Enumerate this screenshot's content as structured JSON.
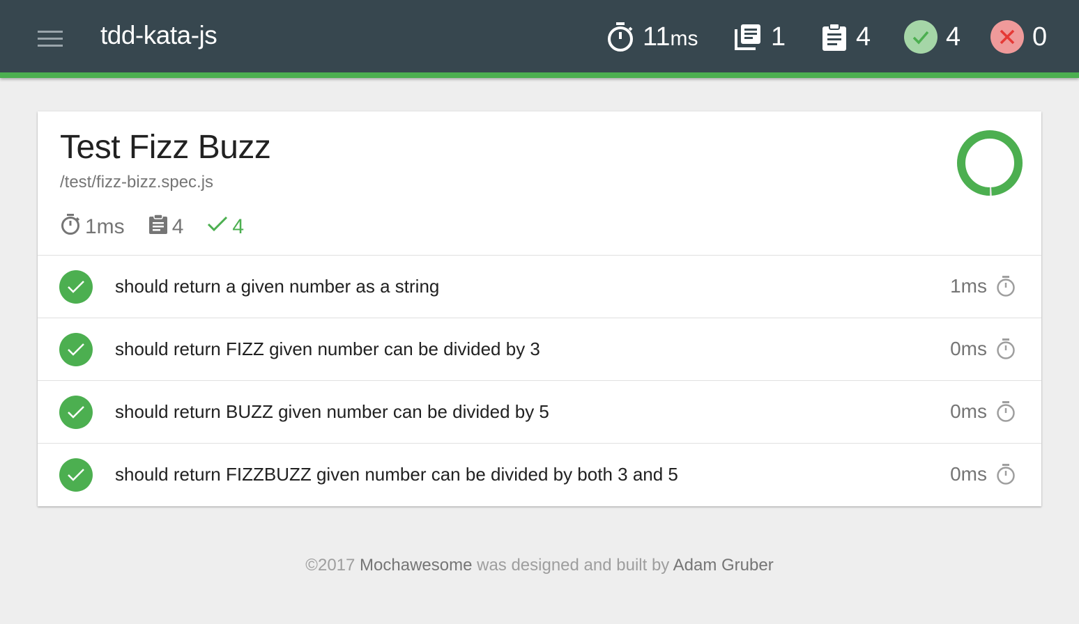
{
  "navbar": {
    "title": "tdd-kata-js",
    "stats": {
      "duration_value": "11",
      "duration_unit": "ms",
      "suites": "1",
      "tests": "4",
      "passes": "4",
      "failures": "0"
    },
    "icons": {
      "menu": "hamburger-icon",
      "duration": "stopwatch-icon",
      "suites": "library-books-icon",
      "tests": "assignment-icon",
      "passes": "check-icon",
      "failures": "close-icon"
    }
  },
  "suite": {
    "title": "Test Fizz Buzz",
    "file": "/test/fizz-bizz.spec.js",
    "duration": "1ms",
    "tests": "4",
    "passes": "4",
    "pass_fraction": 1.0,
    "tests_list": [
      {
        "title": "should return a given number as a string",
        "duration": "1ms",
        "state": "passed"
      },
      {
        "title": "should return FIZZ given number can be divided by 3",
        "duration": "0ms",
        "state": "passed"
      },
      {
        "title": "should return BUZZ given number can be divided by 5",
        "duration": "0ms",
        "state": "passed"
      },
      {
        "title": "should return FIZZBUZZ given number can be divided by both 3 and 5",
        "duration": "0ms",
        "state": "passed"
      }
    ]
  },
  "footer": {
    "prefix": "©2017 ",
    "brand": "Mochawesome",
    "middle": " was designed and built by ",
    "author": "Adam Gruber"
  },
  "colors": {
    "navbar_bg": "#37474f",
    "accent_green": "#4caf50",
    "pass_light": "#a5d6a7",
    "fail_light": "#ef9a9a",
    "fail_dark": "#e53935"
  }
}
